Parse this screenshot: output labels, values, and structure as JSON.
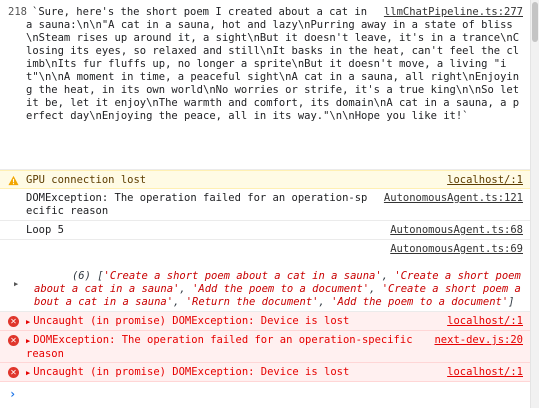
{
  "entries": {
    "log1": {
      "count": "218",
      "text": "`Sure, here's the short poem I created about a cat in a sauna:\\n\\n\"A cat in a sauna, hot and lazy\\nPurring away in a state of bliss\\nSteam rises up around it, a sight\\nBut it doesn't leave, it's in a trance\\nClosing its eyes, so relaxed and still\\nIt basks in the heat, can't feel the climb\\nIts fur fluffs up, no longer a sprite\\nBut it doesn't move, a living \"it\"\\n\\nA moment in time, a peaceful sight\\nA cat in a sauna, all right\\nEnjoying the heat, in its own world\\nNo worries or strife, it's a true king\\n\\nSo let it be, let it enjoy\\nThe warmth and comfort, its domain\\nA cat in a sauna, a perfect day\\nEnjoying the peace, all in its way.\"\\n\\nHope you like it!`",
      "source": "llmChatPipeline.ts:277"
    },
    "warn1": {
      "text": "GPU connection lost",
      "source": "localhost/:1"
    },
    "log2": {
      "text": "DOMException: The operation failed for an operation-specific reason",
      "source": "AutonomousAgent.ts:121"
    },
    "log3": {
      "text": "Loop 5",
      "source": "AutonomousAgent.ts:68"
    },
    "log4": {
      "source": "AutonomousAgent.ts:69",
      "prefix": "(6) [",
      "items": [
        "'Create a short poem about a cat in a sauna'",
        "'Create a short poem about a cat in a sauna'",
        "'Add the poem to a document'",
        "'Create a short poem about a cat in a sauna'",
        "'Return the document'",
        "'Add the poem to a document'"
      ],
      "suffix": "]"
    },
    "err1": {
      "text": "Uncaught (in promise) DOMException: Device is lost",
      "source": "localhost/:1"
    },
    "err2": {
      "text": "DOMException: The operation failed for an operation-specific reason",
      "source": "next-dev.js:20"
    },
    "err3": {
      "text": "Uncaught (in promise) DOMException: Device is lost",
      "source": "localhost/:1"
    }
  },
  "icons": {
    "warning": "warning-icon",
    "error": "error-icon",
    "expand": "expand-triangle-icon",
    "prompt": "console-prompt-icon"
  },
  "colors": {
    "warning_bg": "#fffbe5",
    "error_bg": "#fff0f0",
    "error_text": "#e60000",
    "prompt_accent": "#1a73e8"
  }
}
